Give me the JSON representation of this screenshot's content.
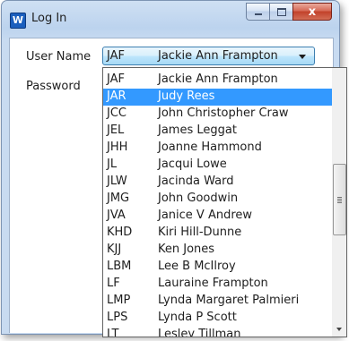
{
  "window": {
    "title": "Log In",
    "app_icon_letter": "W",
    "close_symbol": "x"
  },
  "form": {
    "username_label": "User Name",
    "password_label": "Password"
  },
  "combo": {
    "selected_code": "JAF",
    "selected_name": "Jackie Ann Frampton"
  },
  "dropdown": {
    "highlighted_index": 1,
    "items": [
      {
        "code": "JAF",
        "name": "Jackie Ann Frampton"
      },
      {
        "code": "JAR",
        "name": "Judy Rees"
      },
      {
        "code": "JCC",
        "name": "John Christopher Craw"
      },
      {
        "code": "JEL",
        "name": "James Leggat"
      },
      {
        "code": "JHH",
        "name": "Joanne Hammond"
      },
      {
        "code": "JL",
        "name": "Jacqui Lowe"
      },
      {
        "code": "JLW",
        "name": "Jacinda Ward"
      },
      {
        "code": "JMG",
        "name": "John Goodwin"
      },
      {
        "code": "JVA",
        "name": "Janice V Andrew"
      },
      {
        "code": "KHD",
        "name": "Kiri Hill-Dunne"
      },
      {
        "code": "KJJ",
        "name": "Ken Jones"
      },
      {
        "code": "LBM",
        "name": "Lee B McIlroy"
      },
      {
        "code": "LF",
        "name": "Lauraine Frampton"
      },
      {
        "code": "LMP",
        "name": "Lynda Margaret Palmieri"
      },
      {
        "code": "LPS",
        "name": "Lynda P Scott"
      },
      {
        "code": "LT",
        "name": "Lesley Tillman"
      }
    ]
  },
  "colors": {
    "selection": "#3399ff",
    "title_bar": "#bcd3ee",
    "close_button": "#c2412a"
  }
}
